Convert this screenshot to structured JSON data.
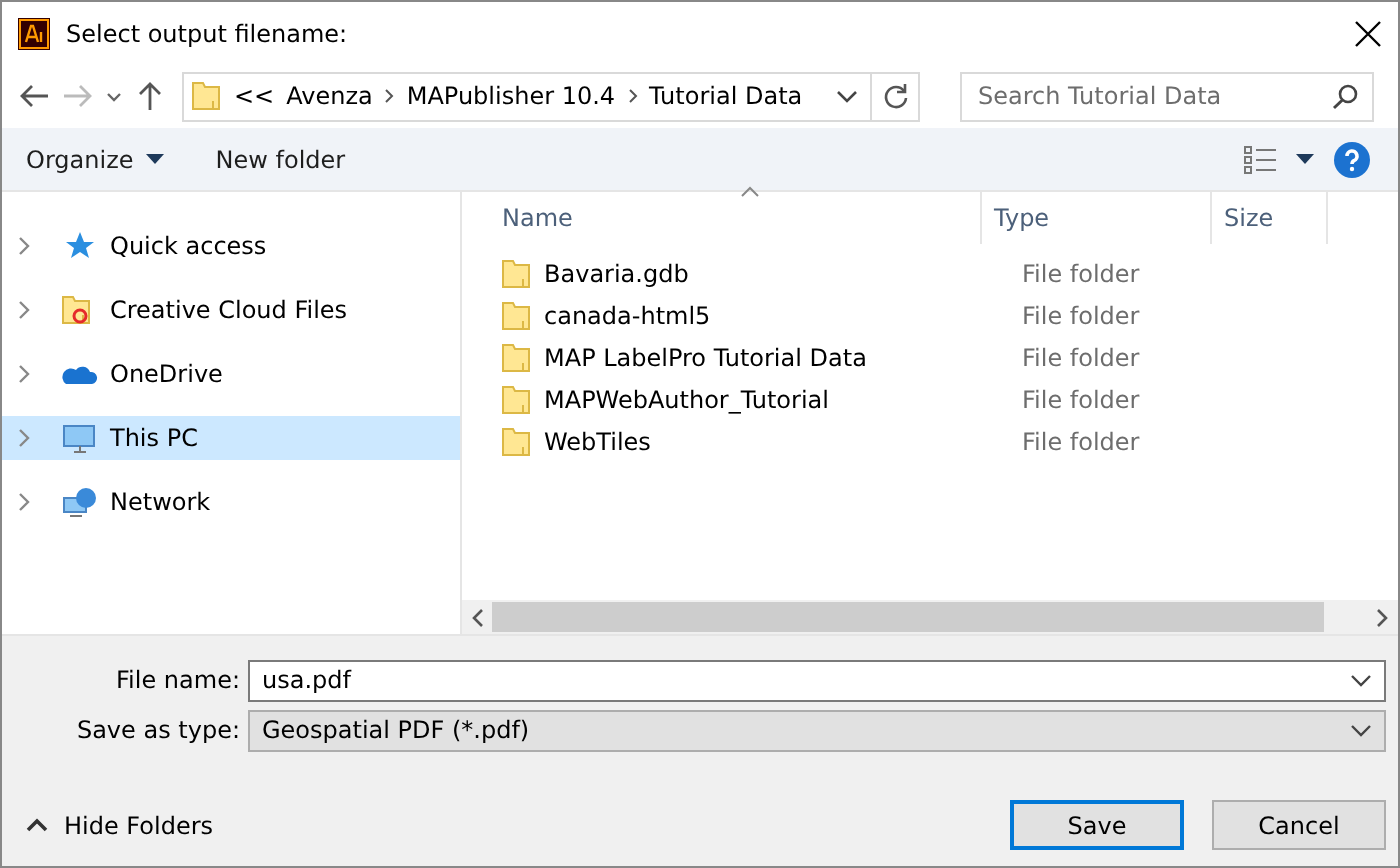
{
  "window": {
    "title": "Select output filename:"
  },
  "address": {
    "overflow": "<<",
    "crumbs": [
      "Avenza",
      "MAPublisher 10.4",
      "Tutorial Data"
    ]
  },
  "search": {
    "placeholder": "Search Tutorial Data"
  },
  "toolbar": {
    "organize": "Organize",
    "new_folder": "New folder"
  },
  "sidebar": {
    "items": [
      {
        "label": "Quick access",
        "kind": "star",
        "selected": false
      },
      {
        "label": "Creative Cloud Files",
        "kind": "cloudfiles",
        "selected": false
      },
      {
        "label": "OneDrive",
        "kind": "onedrive",
        "selected": false
      },
      {
        "label": "This PC",
        "kind": "pc",
        "selected": true
      },
      {
        "label": "Network",
        "kind": "network",
        "selected": false
      }
    ]
  },
  "table": {
    "columns": [
      "Name",
      "Type",
      "Size"
    ],
    "rows": [
      {
        "name": "Bavaria.gdb",
        "type": "File folder"
      },
      {
        "name": "canada-html5",
        "type": "File folder"
      },
      {
        "name": "MAP LabelPro Tutorial Data",
        "type": "File folder"
      },
      {
        "name": "MAPWebAuthor_Tutorial",
        "type": "File folder"
      },
      {
        "name": "WebTiles",
        "type": "File folder"
      }
    ]
  },
  "form": {
    "file_name_label": "File name:",
    "file_name": "usa.pdf",
    "type_label": "Save as type:",
    "type": "Geospatial PDF (*.pdf)"
  },
  "footer": {
    "hide_folders": "Hide Folders",
    "buttons": [
      {
        "label": "Save",
        "kind": "primary"
      },
      {
        "label": "Cancel",
        "kind": "normal"
      }
    ]
  }
}
